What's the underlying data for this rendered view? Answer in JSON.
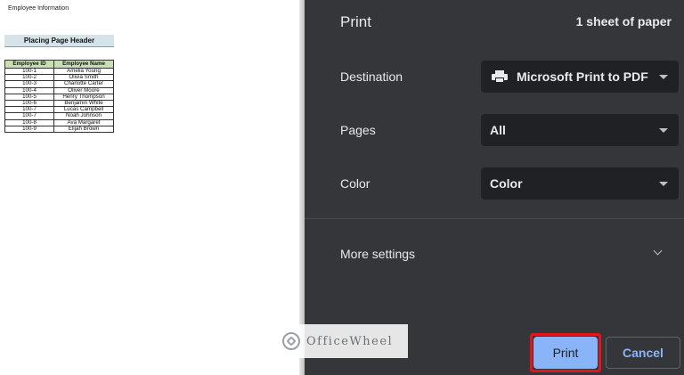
{
  "preview": {
    "doc_header": "Employee Information",
    "sheet_title": "Placing Page Header",
    "table": {
      "headers": [
        "Employee ID",
        "Employee Name"
      ],
      "rows": [
        [
          "100-1",
          "Amelia Young"
        ],
        [
          "100-2",
          "Olivia Smith"
        ],
        [
          "100-3",
          "Charlotte Carter"
        ],
        [
          "100-4",
          "Oliver Moore"
        ],
        [
          "100-5",
          "Henry Thompson"
        ],
        [
          "100-6",
          "Benjamin White"
        ],
        [
          "100-7",
          "Lucas Campbell"
        ],
        [
          "100-7",
          "Noah Johnson"
        ],
        [
          "100-8",
          "Ava Margaret"
        ],
        [
          "100-9",
          "Elijah Brown"
        ]
      ]
    }
  },
  "dialog": {
    "title": "Print",
    "sheet_count": "1 sheet of paper",
    "destination": {
      "label": "Destination",
      "value": "Microsoft Print to PDF",
      "icon": "printer-icon"
    },
    "pages": {
      "label": "Pages",
      "value": "All"
    },
    "color": {
      "label": "Color",
      "value": "Color"
    },
    "more_settings": "More settings",
    "print_label": "Print",
    "cancel_label": "Cancel"
  },
  "watermark": {
    "text": "OfficeWheel"
  },
  "colors": {
    "dialog_bg": "#35363a",
    "select_bg": "#202124",
    "accent": "#8ab4f8",
    "highlight": "#e3141c"
  }
}
